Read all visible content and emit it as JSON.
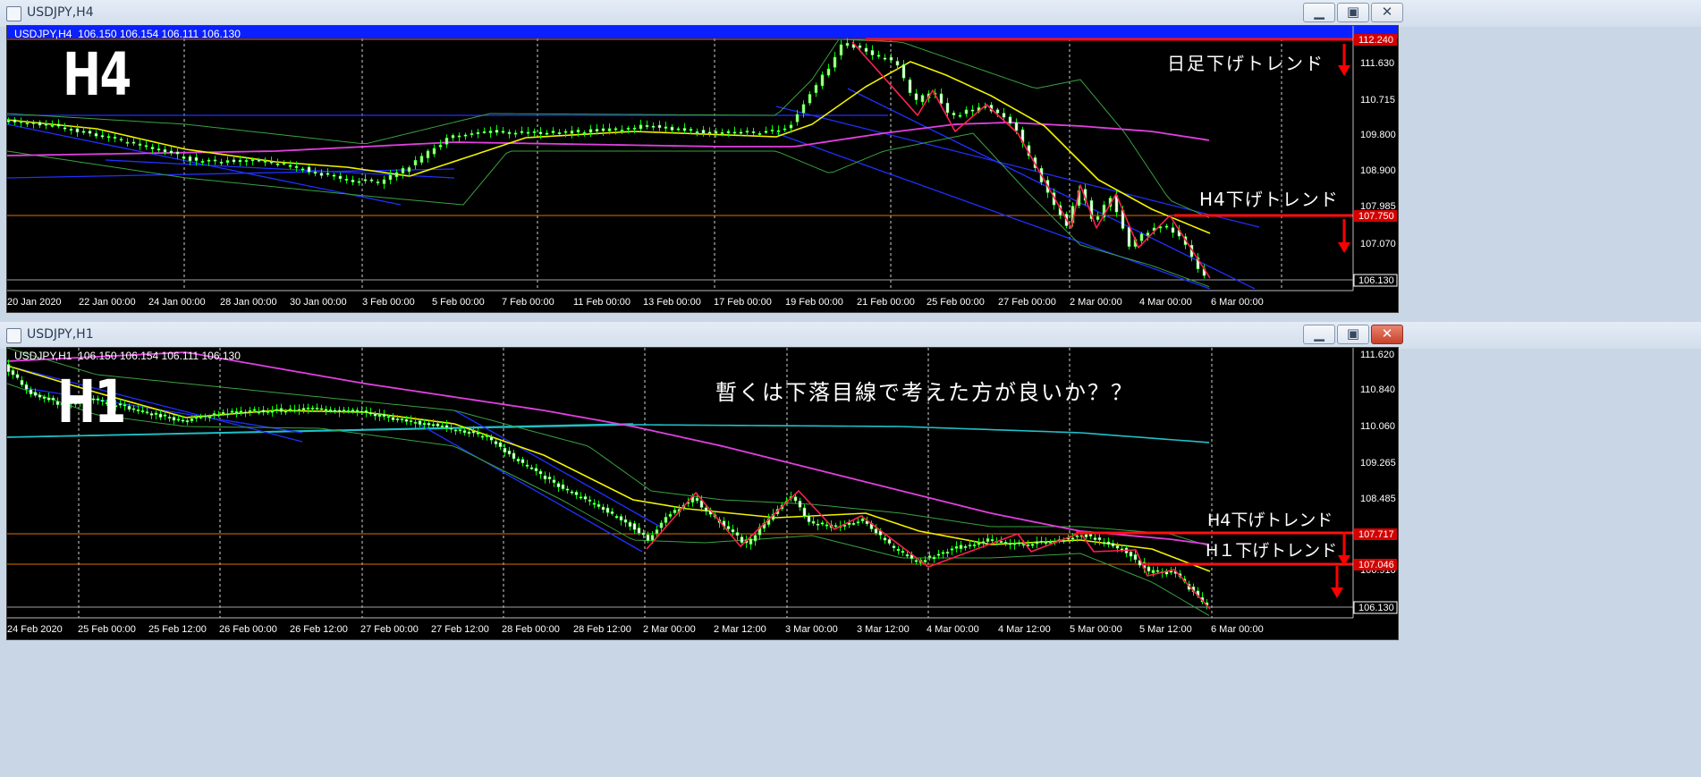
{
  "top": {
    "window_title": "USDJPY,H4",
    "header": "USDJPY,H4  106.150 106.154 106.111 106.130",
    "big_label": "H4",
    "annotation_1": "日足下げトレンド",
    "annotation_2": "H4下げトレンド",
    "price_ticks": [
      "111.630",
      "110.715",
      "109.800",
      "108.900",
      "107.985",
      "107.070"
    ],
    "price_markers": [
      {
        "label": "112.240",
        "color": "#d40000"
      },
      {
        "label": "107.750",
        "color": "#d40000"
      },
      {
        "label": "106.130",
        "color": "#000000"
      }
    ],
    "time_labels": [
      "20 Jan 2020",
      "22 Jan 00:00",
      "24 Jan 00:00",
      "28 Jan 00:00",
      "30 Jan 00:00",
      "3 Feb 00:00",
      "5 Feb 00:00",
      "7 Feb 00:00",
      "11 Feb 00:00",
      "13 Feb 00:00",
      "17 Feb 00:00",
      "19 Feb 00:00",
      "21 Feb 00:00",
      "25 Feb 00:00",
      "27 Feb 00:00",
      "2 Mar 00:00",
      "4 Mar 00:00",
      "6 Mar 00:00"
    ]
  },
  "bottom": {
    "window_title": "USDJPY,H1",
    "header": "USDJPY,H1  106.150 106.154 106.111 106.130",
    "big_label": "H1",
    "comment": "暫くは下落目線で考えた方が良いか？？",
    "annotation_1": "H4下げトレンド",
    "annotation_2": "H１下げトレンド",
    "price_ticks": [
      "111.620",
      "110.840",
      "110.060",
      "109.265",
      "108.485",
      "106.910"
    ],
    "price_markers": [
      {
        "label": "107.717",
        "color": "#d40000"
      },
      {
        "label": "107.046",
        "color": "#d40000"
      },
      {
        "label": "106.130",
        "color": "#000000"
      }
    ],
    "time_labels": [
      "24 Feb 2020",
      "25 Feb 00:00",
      "25 Feb 12:00",
      "26 Feb 00:00",
      "26 Feb 12:00",
      "27 Feb 00:00",
      "27 Feb 12:00",
      "28 Feb 00:00",
      "28 Feb 12:00",
      "2 Mar 00:00",
      "2 Mar 12:00",
      "3 Mar 00:00",
      "3 Mar 12:00",
      "4 Mar 00:00",
      "4 Mar 12:00",
      "5 Mar 00:00",
      "5 Mar 12:00",
      "6 Mar 00:00"
    ]
  },
  "colors": {
    "up": "#b8ff9a",
    "down": "#ffffff",
    "wick": "#00ff00",
    "ma_fast": "#f2f200",
    "ma_slow": "#e040e0",
    "band": "#3aa040",
    "channel": "#2030ff",
    "hline": "#e07000",
    "trend": "#ff2050",
    "hline_cyan": "#20c0c8"
  }
}
